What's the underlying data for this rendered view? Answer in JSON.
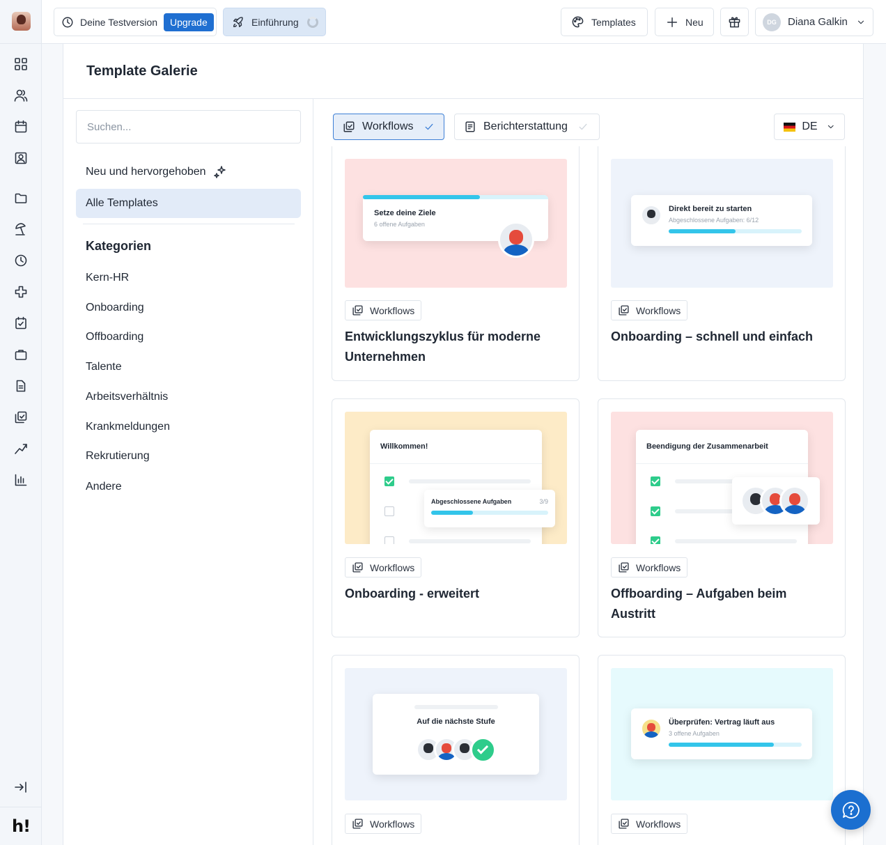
{
  "topbar": {
    "trial_label": "Deine Testversion",
    "upgrade_label": "Upgrade",
    "intro_label": "Einführung",
    "templates_label": "Templates",
    "new_label": "Neu",
    "user_initials": "DG",
    "user_name": "Diana Galkin"
  },
  "rail": {
    "logo": "h!"
  },
  "gallery": {
    "title": "Template Galerie",
    "search_placeholder": "Suchen...",
    "featured_label": "Neu und hervorgehoben",
    "all_templates_label": "Alle Templates",
    "categories_title": "Kategorien",
    "categories": [
      "Kern-HR",
      "Onboarding",
      "Offboarding",
      "Talente",
      "Arbeitsverhältnis",
      "Krankmeldungen",
      "Rekrutierung",
      "Andere"
    ]
  },
  "filters": {
    "workflows_label": "Workflows",
    "reporting_label": "Berichterstattung",
    "language": "DE"
  },
  "cards": [
    {
      "tag": "Workflows",
      "title": "Entwicklungszyklus für moderne Unternehmen",
      "preview_title": "Setze deine Ziele",
      "preview_sub": "6 offene Aufgaben",
      "progress": 0.63
    },
    {
      "tag": "Workflows",
      "title": "Onboarding – schnell und einfach",
      "preview_title": "Direkt bereit zu starten",
      "preview_sub": "Abgeschlossene Aufgaben: 6/12",
      "progress": 0.5
    },
    {
      "tag": "Workflows",
      "title": "Onboarding - erweitert",
      "preview_title": "Willkommen!",
      "preview_sub": "Abgeschlossene Aufgaben",
      "preview_count": "3/9",
      "progress": 0.36
    },
    {
      "tag": "Workflows",
      "title": "Offboarding – Aufgaben beim Austritt",
      "preview_title": "Beendigung der Zusammenarbeit"
    },
    {
      "tag": "Workflows",
      "preview_title": "Auf die nächste Stufe"
    },
    {
      "tag": "Workflows",
      "preview_title": "Überprüfen: Vertrag läuft aus",
      "preview_sub": "3 offene Aufgaben",
      "progress": 0.79
    }
  ],
  "colors": {
    "accent": "#1f6fd1",
    "pink_bg": "#fde1e1",
    "blue_bg": "#eef3fb",
    "yellow_bg": "#fdebc7",
    "cyan_bg": "#e6fafd",
    "progress": "#33c5ea",
    "check": "#2ecc8b"
  }
}
